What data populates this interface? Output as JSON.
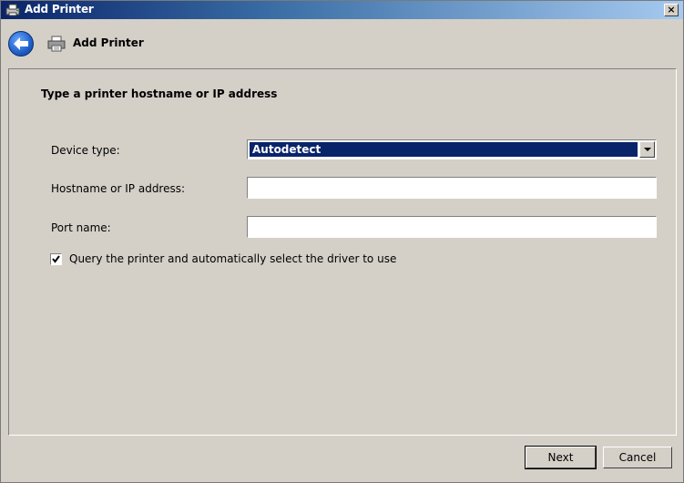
{
  "window": {
    "title": "Add Printer",
    "close_glyph": "×"
  },
  "nav": {
    "title": "Add Printer",
    "back_icon": "back-arrow-icon",
    "printer_icon": "printer-icon"
  },
  "main": {
    "heading": "Type a printer hostname or IP address",
    "device_type_label": "Device type:",
    "device_type_value": "Autodetect",
    "hostname_label": "Hostname or IP address:",
    "hostname_value": "",
    "port_label": "Port name:",
    "port_value": "",
    "query_checkbox_label": "Query the printer and automatically select the driver to use",
    "query_checkbox_checked": true
  },
  "footer": {
    "next_label": "Next",
    "cancel_label": "Cancel"
  },
  "colors": {
    "title_gradient_start": "#0a246a",
    "selection": "#0a246a",
    "face": "#d4d0c8"
  }
}
